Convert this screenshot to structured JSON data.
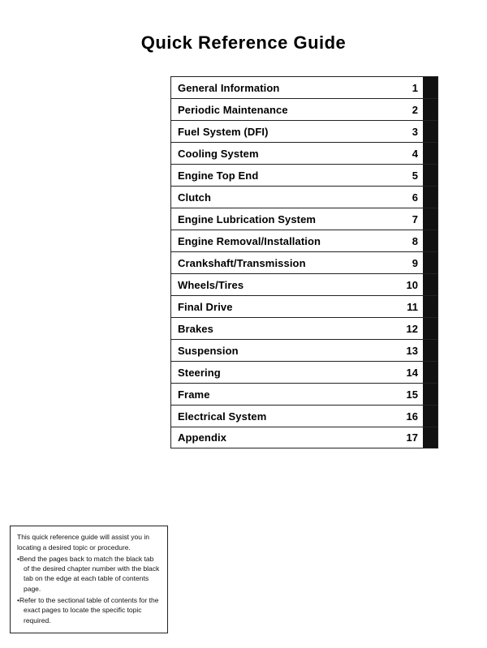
{
  "title": "Quick Reference Guide",
  "rows": [
    {
      "label": "General Information",
      "num": "1"
    },
    {
      "label": "Periodic Maintenance",
      "num": "2"
    },
    {
      "label": "Fuel System (DFI)",
      "num": "3"
    },
    {
      "label": "Cooling System",
      "num": "4"
    },
    {
      "label": "Engine Top End",
      "num": "5"
    },
    {
      "label": "Clutch",
      "num": "6"
    },
    {
      "label": "Engine Lubrication System",
      "num": "7"
    },
    {
      "label": "Engine Removal/Installation",
      "num": "8"
    },
    {
      "label": "Crankshaft/Transmission",
      "num": "9"
    },
    {
      "label": "Wheels/Tires",
      "num": "10"
    },
    {
      "label": "Final Drive",
      "num": "11"
    },
    {
      "label": "Brakes",
      "num": "12"
    },
    {
      "label": "Suspension",
      "num": "13"
    },
    {
      "label": "Steering",
      "num": "14"
    },
    {
      "label": "Frame",
      "num": "15"
    },
    {
      "label": "Electrical System",
      "num": "16"
    },
    {
      "label": "Appendix",
      "num": "17"
    }
  ],
  "note": {
    "line1": "This quick reference guide will assist you in locating a desired topic or procedure.",
    "line2": "•Bend the pages back to match the black tab of the desired chapter number with the black tab on the edge at each table of contents page.",
    "line3": "•Refer to the sectional table of contents for the exact pages to locate the specific topic required."
  }
}
